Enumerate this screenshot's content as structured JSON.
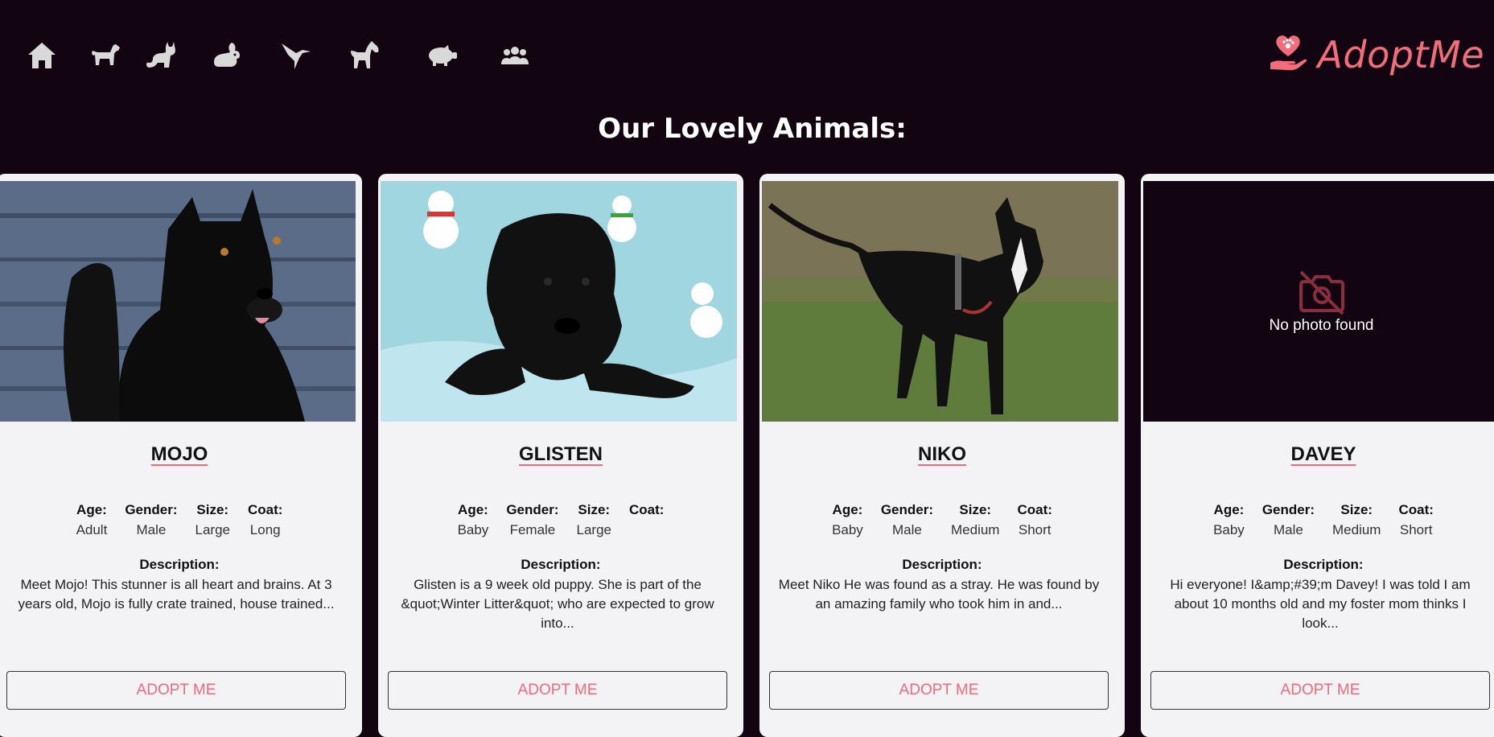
{
  "nav": {
    "icons": [
      {
        "name": "home-icon"
      },
      {
        "name": "dog-icon"
      },
      {
        "name": "cat-icon"
      },
      {
        "name": "rabbit-icon"
      },
      {
        "name": "bird-icon"
      },
      {
        "name": "horse-icon"
      },
      {
        "name": "pig-icon"
      },
      {
        "name": "users-icon"
      }
    ],
    "brand": {
      "text": "AdoptMe",
      "icon": "heart-hand-paw-icon"
    }
  },
  "page": {
    "title": "Our Lovely Animals:"
  },
  "labels": {
    "age": "Age:",
    "gender": "Gender:",
    "size": "Size:",
    "coat": "Coat:",
    "description": "Description:",
    "adopt": "ADOPT ME",
    "no_photo": "No photo found"
  },
  "animals": [
    {
      "name": "MOJO",
      "age": "Adult",
      "gender": "Male",
      "size": "Large",
      "coat": "Long",
      "description": "Meet Mojo! This stunner is all heart and brains. At 3 years old, Mojo is fully crate trained, house trained...",
      "photo": "black long-haired dog"
    },
    {
      "name": "GLISTEN",
      "age": "Baby",
      "gender": "Female",
      "size": "Large",
      "coat": "",
      "description": "Glisten is a 9 week old puppy. She is part of the &quot;Winter Litter&quot; who are expected to grow into...",
      "photo": "black puppy on snowman blanket"
    },
    {
      "name": "NIKO",
      "age": "Baby",
      "gender": "Male",
      "size": "Medium",
      "coat": "Short",
      "description": "Meet Niko He was found as a stray. He was found by an amazing family who took him in and...",
      "photo": "black and white dog on grass"
    },
    {
      "name": "DAVEY",
      "age": "Baby",
      "gender": "Male",
      "size": "Medium",
      "coat": "Short",
      "description": "Hi everyone! I&amp;#39;m Davey! I was told I am about 10 months old and my foster mom thinks I look...",
      "photo": null
    }
  ],
  "colors": {
    "background": "#120410",
    "accent": "#f26d7b",
    "card": "#f3f2f4",
    "icon": "#d9d9d9"
  }
}
